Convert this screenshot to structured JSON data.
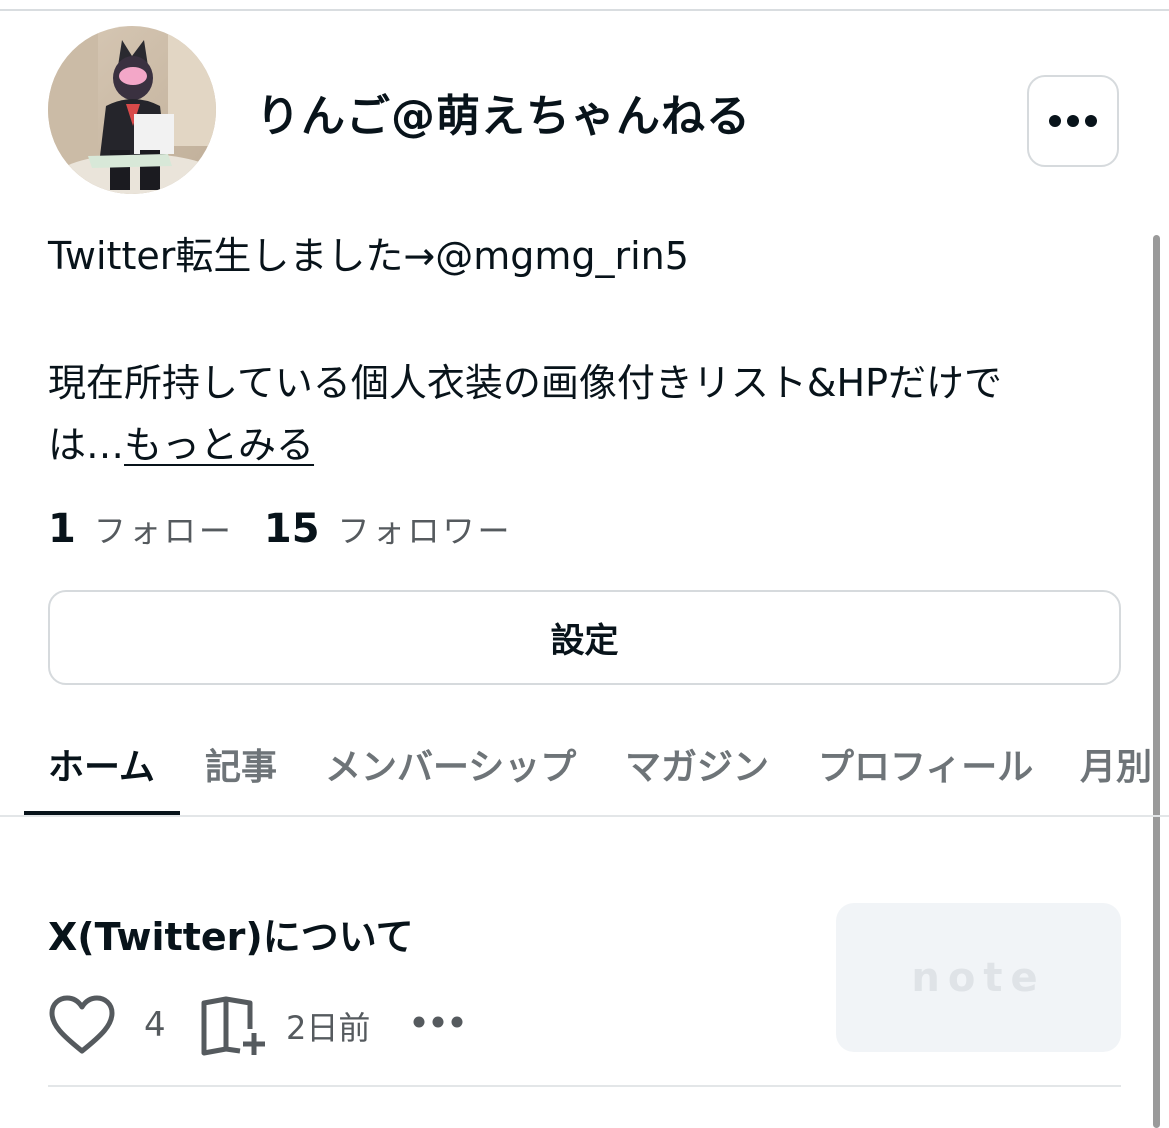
{
  "profile": {
    "name": "りんご@萌えちゃんねる",
    "bio_line1": "Twitter転生しました→@mgmg_rin5",
    "bio_line2": "現在所持している個人衣装の画像付きリスト&HPだけで",
    "bio_line3_prefix": "は…",
    "more_link": "もっとみる"
  },
  "stats": {
    "following_count": "1",
    "following_label": "フォロー",
    "followers_count": "15",
    "followers_label": "フォロワー"
  },
  "settings_button": "設定",
  "tabs": [
    {
      "label": "ホーム",
      "active": true
    },
    {
      "label": "記事"
    },
    {
      "label": "メンバーシップ"
    },
    {
      "label": "マガジン"
    },
    {
      "label": "プロフィール"
    },
    {
      "label": "月別"
    }
  ],
  "article": {
    "title": "X(Twitter)について",
    "likes": "4",
    "time_ago": "2日前",
    "thumbnail_text": "note"
  },
  "colors": {
    "text": "#08131a",
    "muted": "#555a5e",
    "border": "#d6dadd",
    "thumbnail_bg": "#f1f4f7"
  },
  "icons": [
    "more-dots-icon",
    "heart-icon",
    "magazine-add-icon",
    "more-dots-icon"
  ]
}
